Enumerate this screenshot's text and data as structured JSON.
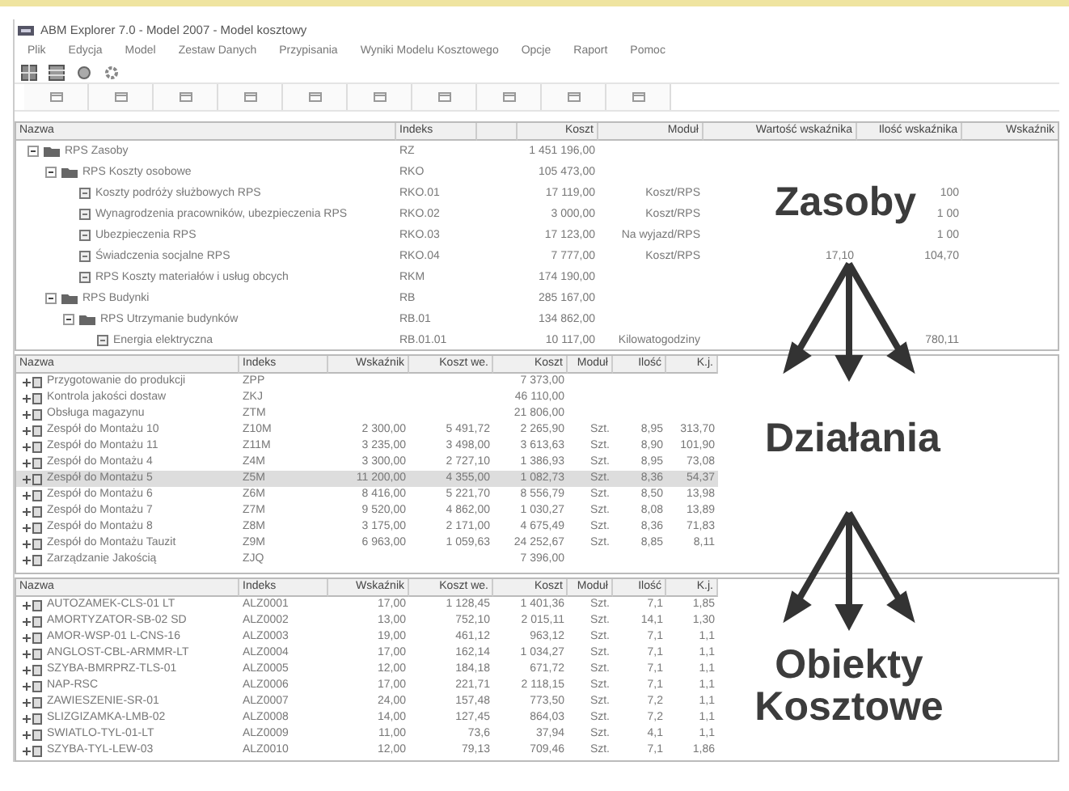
{
  "window": {
    "title": "ABM Explorer 7.0 - Model 2007 - Model kosztowy"
  },
  "menu": [
    "Plik",
    "Edycja",
    "Model",
    "Zestaw Danych",
    "Przypisania",
    "Wyniki Modelu Kosztowego",
    "Opcje",
    "Raport",
    "Pomoc"
  ],
  "resources_pane": {
    "columns": [
      "Nazwa",
      "Indeks",
      "",
      "Koszt",
      "Moduł",
      "Wartość wskaźnika",
      "Ilość wskaźnika",
      "Wskaźnik"
    ],
    "rows": [
      {
        "cells": [
          "RPS Zasoby",
          "RZ",
          "",
          "1 451 196,00",
          "",
          "",
          "",
          ""
        ],
        "expanded": true,
        "children": [
          {
            "cells": [
              "RPS Koszty osobowe",
              "RKO",
              "",
              "105 473,00",
              "",
              "",
              "",
              ""
            ],
            "expanded": true,
            "children": [
              {
                "cells": [
                  "Koszty podróży służbowych RPS",
                  "RKO.01",
                  "",
                  "17 119,00",
                  "Koszt/RPS",
                  "",
                  "100",
                  ""
                ]
              },
              {
                "cells": [
                  "Wynagrodzenia pracowników, ubezpieczenia RPS",
                  "RKO.02",
                  "",
                  "3 000,00",
                  "Koszt/RPS",
                  "",
                  "1 00",
                  ""
                ]
              },
              {
                "cells": [
                  "Ubezpieczenia RPS",
                  "RKO.03",
                  "",
                  "17 123,00",
                  "Na wyjazd/RPS",
                  "",
                  "1 00",
                  ""
                ]
              },
              {
                "cells": [
                  "Świadczenia socjalne RPS",
                  "RKO.04",
                  "",
                  "7 777,00",
                  "Koszt/RPS",
                  "17,10",
                  "104,70",
                  ""
                ]
              },
              {
                "cells": [
                  "RPS Koszty materiałów i usług obcych",
                  "RKM",
                  "",
                  "174 190,00",
                  "",
                  "",
                  "",
                  ""
                ]
              }
            ]
          },
          {
            "cells": [
              "RPS Budynki",
              "RB",
              "",
              "285 167,00",
              "",
              "",
              "",
              ""
            ],
            "expanded": true,
            "children": [
              {
                "cells": [
                  "RPS Utrzymanie budynków",
                  "RB.01",
                  "",
                  "134 862,00",
                  "",
                  "",
                  "",
                  ""
                ],
                "expanded": true,
                "children": [
                  {
                    "cells": [
                      "Energia elektryczna",
                      "RB.01.01",
                      "",
                      "10 117,00",
                      "Kilowatogodziny",
                      "",
                      "780,11",
                      ""
                    ]
                  }
                ]
              }
            ]
          }
        ]
      }
    ]
  },
  "activities_pane": {
    "columns": [
      "Nazwa",
      "Indeks",
      "Wskaźnik",
      "Koszt we.",
      "Koszt",
      "Moduł",
      "Ilość",
      "K.j."
    ],
    "rows": [
      {
        "cells": [
          "Przygotowanie do produkcji",
          "ZPP",
          "",
          "",
          "7 373,00",
          "",
          "",
          ""
        ],
        "selected": false
      },
      {
        "cells": [
          "Kontrola jakości dostaw",
          "ZKJ",
          "",
          "",
          "46 110,00",
          "",
          "",
          ""
        ],
        "selected": false
      },
      {
        "cells": [
          "Obsługa magazynu",
          "ZTM",
          "",
          "",
          "21 806,00",
          "",
          "",
          ""
        ],
        "selected": false
      },
      {
        "cells": [
          "Zespół do Montażu 10",
          "Z10M",
          "2 300,00",
          "5 491,72",
          "2 265,90",
          "Szt.",
          "8,95",
          "313,70"
        ],
        "selected": false
      },
      {
        "cells": [
          "Zespół do Montażu 11",
          "Z11M",
          "3 235,00",
          "3 498,00",
          "3 613,63",
          "Szt.",
          "8,90",
          "101,90"
        ],
        "selected": false
      },
      {
        "cells": [
          "Zespół do Montażu 4",
          "Z4M",
          "3 300,00",
          "2 727,10",
          "1 386,93",
          "Szt.",
          "8,95",
          "73,08"
        ],
        "selected": false
      },
      {
        "cells": [
          "Zespół do Montażu 5",
          "Z5M",
          "11 200,00",
          "4 355,00",
          "1 082,73",
          "Szt.",
          "8,36",
          "54,37"
        ],
        "selected": true
      },
      {
        "cells": [
          "Zespół do Montażu 6",
          "Z6M",
          "8 416,00",
          "5 221,70",
          "8 556,79",
          "Szt.",
          "8,50",
          "13,98"
        ],
        "selected": false
      },
      {
        "cells": [
          "Zespół do Montażu 7",
          "Z7M",
          "9 520,00",
          "4 862,00",
          "1 030,27",
          "Szt.",
          "8,08",
          "13,89"
        ],
        "selected": false
      },
      {
        "cells": [
          "Zespół do Montażu 8",
          "Z8M",
          "3 175,00",
          "2 171,00",
          "4 675,49",
          "Szt.",
          "8,36",
          "71,83"
        ],
        "selected": false
      },
      {
        "cells": [
          "Zespół do Montażu Tauzit",
          "Z9M",
          "6 963,00",
          "1 059,63",
          "24 252,67",
          "Szt.",
          "8,85",
          "8,11"
        ],
        "selected": false
      },
      {
        "cells": [
          "Zarządzanie Jakością",
          "ZJQ",
          "",
          "",
          "7 396,00",
          "",
          "",
          ""
        ],
        "selected": false
      }
    ]
  },
  "cost_objects_pane": {
    "columns": [
      "Nazwa",
      "Indeks",
      "Wskaźnik",
      "Koszt we.",
      "Koszt",
      "Moduł",
      "Ilość",
      "K.j."
    ],
    "rows": [
      {
        "cells": [
          "AUTOZAMEK-CLS-01 LT",
          "ALZ0001",
          "17,00",
          "1 128,45",
          "1 401,36",
          "Szt.",
          "7,1",
          "1,85"
        ]
      },
      {
        "cells": [
          "AMORTYZATOR-SB-02 SD",
          "ALZ0002",
          "13,00",
          "752,10",
          "2 015,11",
          "Szt.",
          "14,1",
          "1,30"
        ]
      },
      {
        "cells": [
          "AMOR-WSP-01 L-CNS-16",
          "ALZ0003",
          "19,00",
          "461,12",
          "963,12",
          "Szt.",
          "7,1",
          "1,1"
        ]
      },
      {
        "cells": [
          "ANGLOST-CBL-ARMMR-LT",
          "ALZ0004",
          "17,00",
          "162,14",
          "1 034,27",
          "Szt.",
          "7,1",
          "1,1"
        ]
      },
      {
        "cells": [
          "SZYBA-BMRPRZ-TLS-01",
          "ALZ0005",
          "12,00",
          "184,18",
          "671,72",
          "Szt.",
          "7,1",
          "1,1"
        ]
      },
      {
        "cells": [
          "NAP-RSC",
          "ALZ0006",
          "17,00",
          "221,71",
          "2 118,15",
          "Szt.",
          "7,1",
          "1,1"
        ]
      },
      {
        "cells": [
          "ZAWIESZENIE-SR-01",
          "ALZ0007",
          "24,00",
          "157,48",
          "773,50",
          "Szt.",
          "7,2",
          "1,1"
        ]
      },
      {
        "cells": [
          "SLIZGIZAMKA-LMB-02",
          "ALZ0008",
          "14,00",
          "127,45",
          "864,03",
          "Szt.",
          "7,2",
          "1,1"
        ]
      },
      {
        "cells": [
          "SWIATLO-TYL-01-LT",
          "ALZ0009",
          "11,00",
          "73,6",
          "37,94",
          "Szt.",
          "4,1",
          "1,1"
        ]
      },
      {
        "cells": [
          "SZYBA-TYL-LEW-03",
          "ALZ0010",
          "12,00",
          "79,13",
          "709,46",
          "Szt.",
          "7,1",
          "1,86"
        ]
      }
    ]
  },
  "annotations": [
    {
      "kind": "label",
      "text": "Zasoby"
    },
    {
      "kind": "arrows"
    },
    {
      "kind": "label",
      "text": "Działania"
    },
    {
      "kind": "arrows"
    },
    {
      "kind": "label",
      "text": "Obiekty Kosztowe"
    }
  ]
}
